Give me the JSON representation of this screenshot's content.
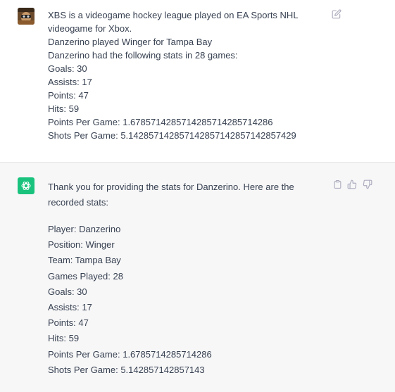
{
  "user_message": {
    "lines": [
      "XBS is a videogame hockey league played on EA Sports NHL",
      "videogame for Xbox.",
      "Danzerino played Winger for Tampa Bay",
      "Danzerino had the following stats in 28 games:",
      "Goals: 30",
      "Assists: 17",
      "Points: 47",
      "Hits: 59",
      "Points Per Game: 1.6785714285714285714285714286",
      "Shots Per Game: 5.142857142857142857142857142857429"
    ],
    "edit_icon": "pencil-edit-icon"
  },
  "assistant_message": {
    "intro": "Thank you for providing the stats for Danzerino. Here are the recorded stats:",
    "lines": [
      "Player: Danzerino",
      "Position: Winger",
      "Team: Tampa Bay",
      "Games Played: 28",
      "Goals: 30",
      "Assists: 17",
      "Points: 47",
      "Hits: 59",
      "Points Per Game: 1.6785714285714286",
      "Shots Per Game: 5.142857142857143"
    ],
    "icons": [
      "clipboard-icon",
      "thumbs-up-icon",
      "thumbs-down-icon"
    ],
    "avatar_color": "#19c37d"
  },
  "colors": {
    "user_bg": "#ffffff",
    "assistant_bg": "#f7f7f8",
    "text": "#374151",
    "icon": "#acacbe"
  }
}
